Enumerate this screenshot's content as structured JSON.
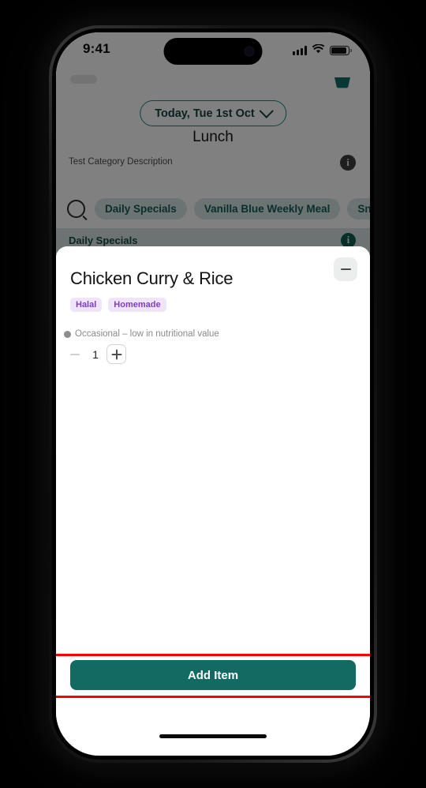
{
  "device": {
    "status_bar": {
      "time": "9:41",
      "cellular_icon": "signal-bars-icon",
      "wifi_icon": "wifi-icon",
      "battery_icon": "battery-icon"
    },
    "home_indicator": "home-indicator"
  },
  "background_app": {
    "basket_icon": "basket-icon",
    "date_selector": {
      "label": "Today, Tue 1st Oct",
      "chevron_icon": "chevron-down-icon"
    },
    "meal_period_title": "Lunch",
    "category_description": "Test Category Description",
    "category_info_icon": "info-icon",
    "search_icon": "search-icon",
    "chips": [
      {
        "label": "Daily Specials"
      },
      {
        "label": "Vanilla Blue Weekly Meal"
      },
      {
        "label": "Sna"
      }
    ],
    "section_header": {
      "label": "Daily Specials",
      "info_icon": "info-icon"
    }
  },
  "sheet": {
    "minimize_icon": "minimize-icon",
    "item_name": "Chicken Curry & Rice",
    "tags": [
      {
        "label": "Halal"
      },
      {
        "label": "Homemade"
      }
    ],
    "nutrition_note": {
      "dot_icon": "status-dot-icon",
      "text": "Occasional – low in nutritional value"
    },
    "quantity_stepper": {
      "decrement_label": "minus-icon",
      "value": "1",
      "increment_label": "plus-icon"
    },
    "primary_action": "Add Item"
  },
  "colors": {
    "brand_teal": "#136a63",
    "chip_teal_text": "#135a52",
    "tag_purple_text": "#7d3fc0",
    "tag_purple_bg": "#f0e4fb",
    "highlight_red": "#ff0000",
    "nutrition_gray": "#8a8a8a"
  }
}
